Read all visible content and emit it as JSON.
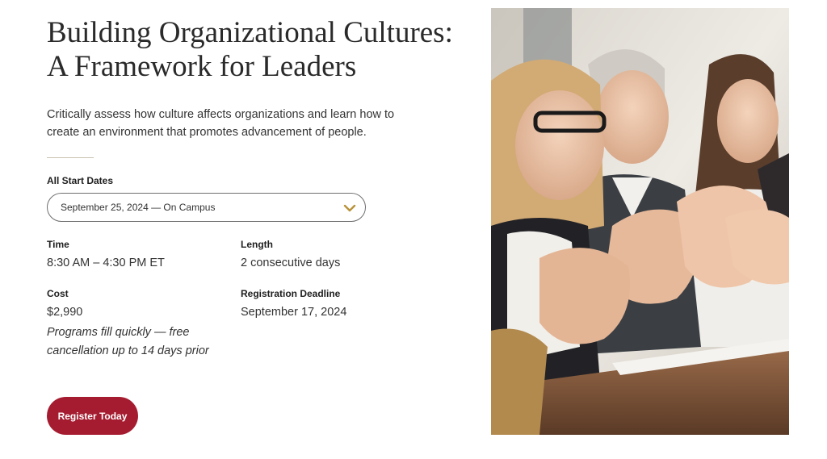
{
  "course": {
    "title_line1": "Building Organizational Cultures:",
    "title_line2": "A Framework for Leaders",
    "description": "Critically assess how culture affects organizations and learn how to create an environment that promotes advancement of people."
  },
  "dates": {
    "label": "All Start Dates",
    "selected": "September 25, 2024 — On Campus",
    "icon": "chevron-down-icon"
  },
  "details": {
    "time_label": "Time",
    "time_value": "8:30 AM – 4:30 PM ET",
    "length_label": "Length",
    "length_value": "2 consecutive days",
    "cost_label": "Cost",
    "cost_value": "$2,990",
    "cost_note": "Programs fill quickly — free cancellation up to 14 days prior",
    "deadline_label": "Registration Deadline",
    "deadline_value": "September 17, 2024"
  },
  "cta": {
    "register_label": "Register Today"
  },
  "colors": {
    "accent": "#a51c30",
    "chevron": "#b8923a"
  }
}
